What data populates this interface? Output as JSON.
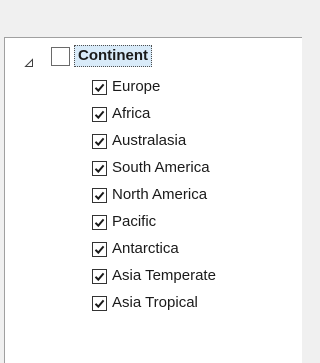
{
  "tree": {
    "root": {
      "label": "Continent",
      "checked": false,
      "expanded": true
    },
    "children": [
      {
        "label": "Europe",
        "checked": true
      },
      {
        "label": "Africa",
        "checked": true
      },
      {
        "label": "Australasia",
        "checked": true
      },
      {
        "label": "South America",
        "checked": true
      },
      {
        "label": "North America",
        "checked": true
      },
      {
        "label": "Pacific",
        "checked": true
      },
      {
        "label": "Antarctica",
        "checked": true
      },
      {
        "label": "Asia Temperate",
        "checked": true
      },
      {
        "label": "Asia Tropical",
        "checked": true
      }
    ]
  },
  "icons": {
    "expander": "collapse-triangle-icon",
    "check": "checkmark-icon"
  }
}
